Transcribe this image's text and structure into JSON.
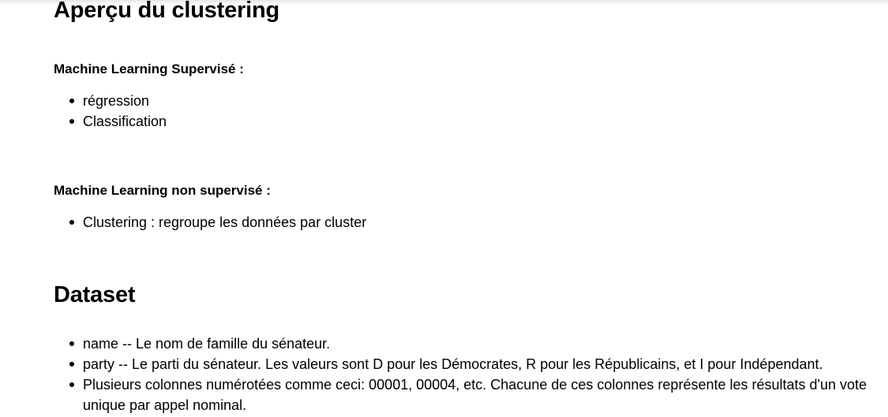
{
  "sections": {
    "clustering": {
      "title": "Aperçu du clustering",
      "supervised": {
        "heading": "Machine Learning Supervisé :",
        "items": [
          "régression",
          "Classification"
        ]
      },
      "unsupervised": {
        "heading": "Machine Learning non supervisé :",
        "items": [
          "Clustering : regroupe les données par cluster"
        ]
      }
    },
    "dataset": {
      "title": "Dataset",
      "items": [
        "name -- Le nom de famille du sénateur.",
        "party -- Le parti du sénateur. Les valeurs sont D pour les Démocrates, R pour les Républicains, et I pour Indépendant.",
        "Plusieurs colonnes numérotées comme ceci: 00001, 00004, etc. Chacune de ces colonnes représente les résultats d'un vote unique par appel nominal."
      ]
    }
  }
}
